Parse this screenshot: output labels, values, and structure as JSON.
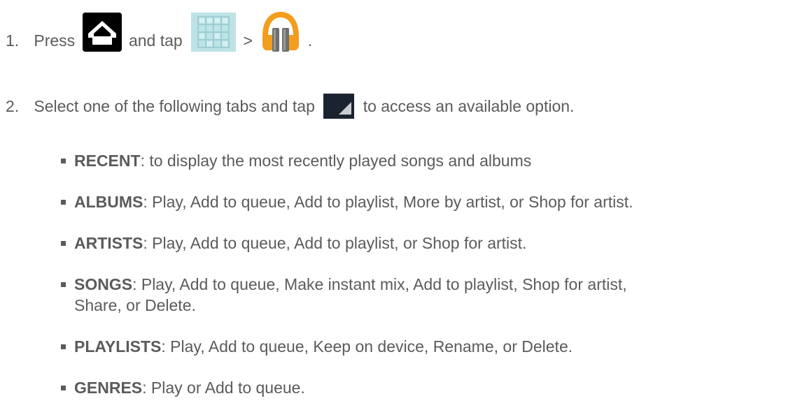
{
  "steps": [
    {
      "number": "1.",
      "text_press": "Press",
      "text_and_tap": "and tap",
      "text_gt": ">",
      "text_end": ".",
      "icons": [
        "home-key-icon",
        "apps-grid-icon",
        "play-music-icon"
      ]
    },
    {
      "number": "2.",
      "text_before": "Select one of the following tabs and tap",
      "text_after": "to access an available option.",
      "icons": [
        "menu-key-icon"
      ]
    }
  ],
  "tabs": [
    {
      "name": "RECENT",
      "description": ": to display the most recently played songs and albums"
    },
    {
      "name": "ALBUMS",
      "description": ": Play, Add to queue, Add to playlist, More by artist, or Shop for artist."
    },
    {
      "name": "ARTISTS",
      "description": ": Play, Add to queue, Add to playlist, or Shop for artist."
    },
    {
      "name": "SONGS",
      "description": ": Play, Add to queue, Make instant mix, Add to playlist, Shop for artist,",
      "description_line2": "Share, or Delete."
    },
    {
      "name": "PLAYLISTS",
      "description": ": Play, Add to queue, Keep on device, Rename, or Delete."
    },
    {
      "name": "GENRES",
      "description": ": Play or Add to queue."
    }
  ],
  "colors": {
    "text": "#5b5b5b",
    "music_orange": "#f29d1e"
  }
}
